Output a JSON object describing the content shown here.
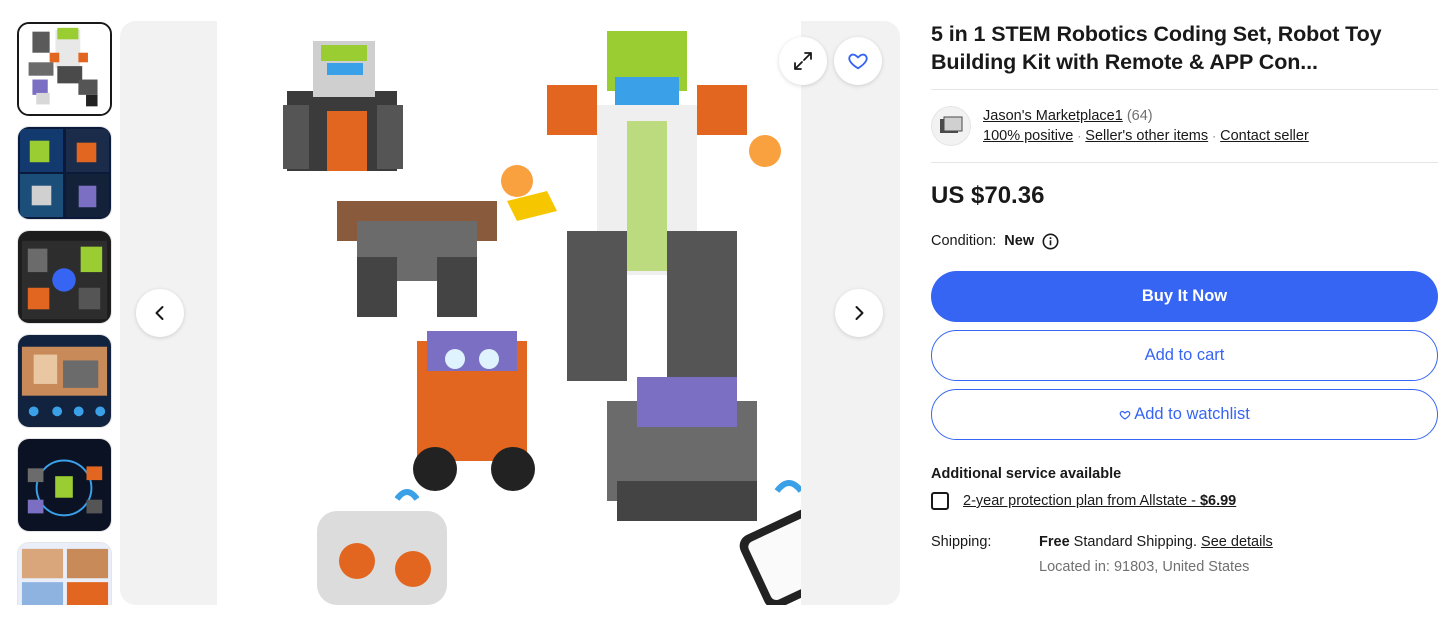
{
  "gallery": {
    "thumbnail_count": 6,
    "active_thumbnail": 0,
    "expand_icon": "expand-icon",
    "watch_icon": "heart-icon",
    "prev_icon": "chevron-left-icon",
    "next_icon": "chevron-right-icon"
  },
  "listing": {
    "title": "5 in 1 STEM Robotics Coding Set, Robot Toy Building Kit with Remote & APP Con..."
  },
  "seller": {
    "name": "Jason's Marketplace1",
    "feedback_count": "(64)",
    "positive": "100% positive",
    "other_items": "Seller's other items",
    "contact": "Contact seller"
  },
  "price": "US $70.36",
  "condition": {
    "label": "Condition:",
    "value": "New"
  },
  "actions": {
    "buy_now": "Buy It Now",
    "add_to_cart": "Add to cart",
    "add_to_watchlist": "Add to watchlist"
  },
  "services": {
    "heading": "Additional service available",
    "protection_plan": "2-year protection plan from Allstate - ",
    "protection_price": "$6.99"
  },
  "shipping": {
    "label": "Shipping:",
    "free": "Free",
    "method": " Standard Shipping. ",
    "details_link": "See details",
    "location": "Located in: 91803, United States"
  },
  "colors": {
    "accent_blue": "#3665f3",
    "text": "#191919",
    "muted": "#707070",
    "divider": "#e5e5e5"
  }
}
